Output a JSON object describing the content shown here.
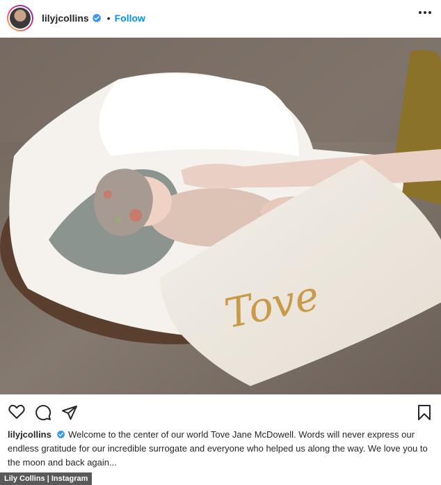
{
  "header": {
    "username": "lilyjcollins",
    "separator": "•",
    "follow_label": "Follow"
  },
  "post": {
    "blanket_text": "Tove"
  },
  "caption": {
    "username": "lilyjcollins",
    "text": "Welcome to the center of our world Tove Jane McDowell. Words will never express our endless gratitude for our incredible surrogate and everyone who helped us along the way. We love you to the moon and back again..."
  },
  "credit": {
    "text": "Lily Collins | Instagram"
  },
  "icons": [
    "verified-badge-icon",
    "more-options-icon",
    "heart-icon",
    "comment-icon",
    "share-icon",
    "bookmark-icon"
  ],
  "colors": {
    "follow": "#0095f6",
    "verified": "#3897f0",
    "text": "#262626"
  }
}
